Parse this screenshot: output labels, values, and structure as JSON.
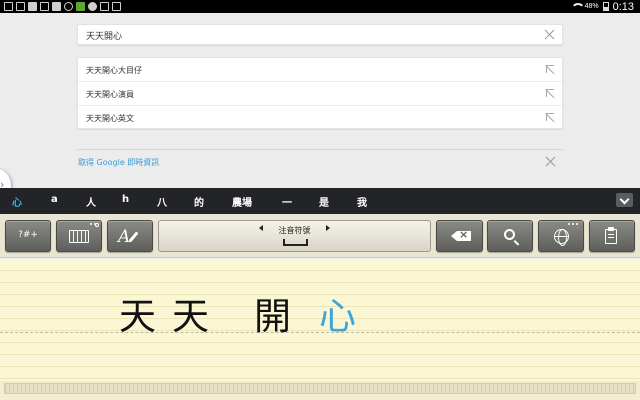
{
  "status_bar": {
    "left_icons": [
      "keyboard-icon",
      "phone-icon",
      "image-icon",
      "cloud-upload-icon",
      "facebook-icon",
      "android-icon",
      "line-icon",
      "forward-icon",
      "book-icon",
      "checkbox-icon"
    ],
    "battery": "48%",
    "time": "0:13"
  },
  "search": {
    "query": "天天開心"
  },
  "suggestions": [
    {
      "text": "天天開心大目仔"
    },
    {
      "text": "天天開心演員"
    },
    {
      "text": "天天開心英文"
    }
  ],
  "google_now": {
    "text": "取得 Google 即時資訊"
  },
  "side_tab": {
    "glyph": "›"
  },
  "candidates": {
    "items": [
      "心",
      "a",
      "人",
      "h",
      "八",
      "的",
      "農場",
      "一",
      "是",
      "我"
    ],
    "active_index": 0,
    "active_color": "#35b0e6"
  },
  "toolbar": {
    "symbols_label": "?#+",
    "input_method_label": "注音符號"
  },
  "handwriting": {
    "chars": [
      {
        "char": "天",
        "color": "#111111"
      },
      {
        "char": "天",
        "color": "#111111"
      },
      {
        "char": "開",
        "color": "#111111"
      },
      {
        "char": "心",
        "color": "#38a6dc"
      }
    ]
  }
}
